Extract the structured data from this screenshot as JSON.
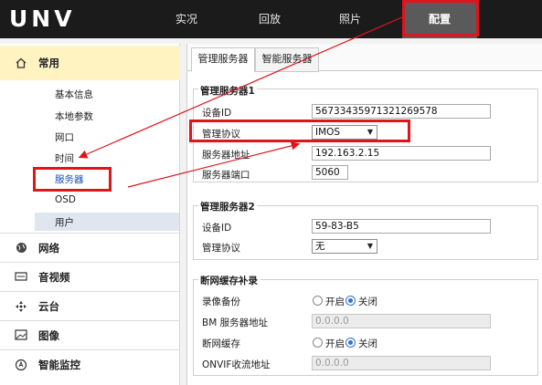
{
  "app": {
    "logo": "UNV"
  },
  "nav": {
    "items": [
      "实况",
      "回放",
      "照片",
      "配置"
    ],
    "active_index": 3
  },
  "sidebar": {
    "group_common": {
      "label": "常用",
      "items": [
        "基本信息",
        "本地参数",
        "网口",
        "时间",
        "服务器",
        "OSD",
        "用户"
      ],
      "active_item": "服务器"
    },
    "categories": [
      {
        "label": "网络",
        "icon": "globe-icon"
      },
      {
        "label": "音视频",
        "icon": "video-icon"
      },
      {
        "label": "云台",
        "icon": "ptz-icon"
      },
      {
        "label": "图像",
        "icon": "image-icon"
      },
      {
        "label": "智能监控",
        "icon": "smart-icon"
      }
    ]
  },
  "tabs": {
    "items": [
      "管理服务器",
      "智能服务器"
    ],
    "active_index": 0
  },
  "server1": {
    "legend": "管理服务器1",
    "device_id_label": "设备ID",
    "device_id_value": "56733435971321269578",
    "protocol_label": "管理协议",
    "protocol_value": "IMOS",
    "address_label": "服务器地址",
    "address_value": "192.163.2.15",
    "port_label": "服务器端口",
    "port_value": "5060"
  },
  "server2": {
    "legend": "管理服务器2",
    "device_id_label": "设备ID",
    "device_id_value": "59-83-B5",
    "protocol_label": "管理协议",
    "protocol_value": "无"
  },
  "cache": {
    "legend": "断网缓存补录",
    "record_backup_label": "录像备份",
    "record_backup_on": "开启",
    "record_backup_off": "关闭",
    "record_backup_value": "关闭",
    "bm_address_label": "BM 服务器地址",
    "bm_address_value": "0.0.0.0",
    "offline_cache_label": "断网缓存",
    "offline_cache_on": "开启",
    "offline_cache_off": "关闭",
    "offline_cache_value": "关闭",
    "onvif_label": "ONVIF收流地址",
    "onvif_value": "0.0.0.0"
  },
  "annotation": {
    "color": "#e0141b"
  },
  "colors": {
    "header": "#1b1b1b",
    "accent": "#2f6fd6",
    "highlight_row": "#fff3c2"
  }
}
